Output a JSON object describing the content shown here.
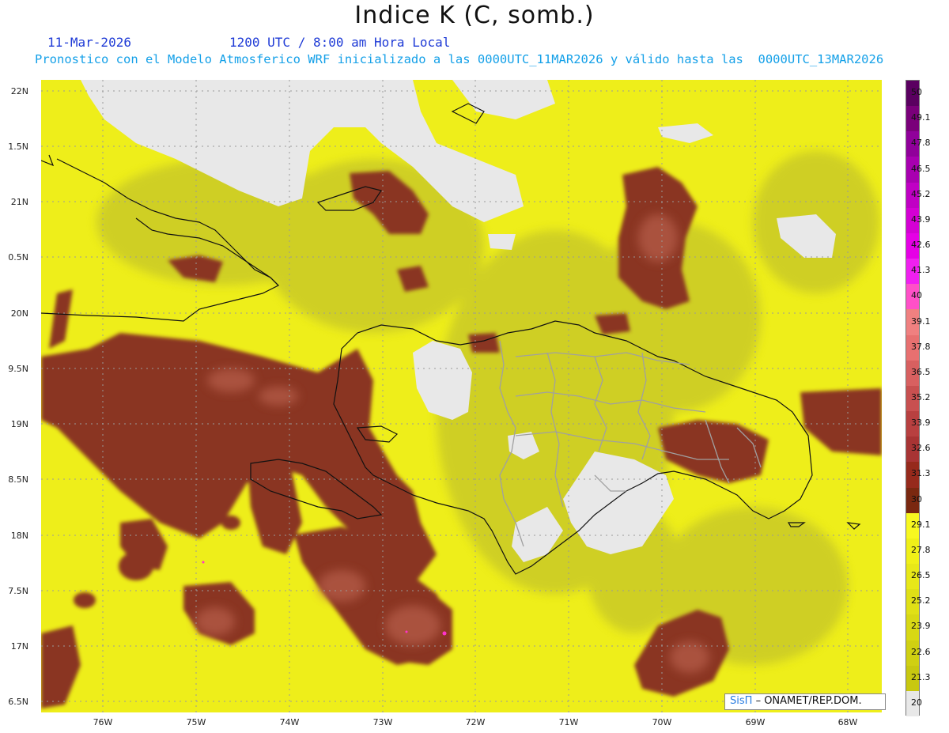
{
  "header": {
    "title": "Indice K (C, somb.)",
    "date": "11-Mar-2026",
    "time": "1200 UTC / 8:00 am Hora Local",
    "forecast_line": "Pronostico con el Modelo Atmosferico WRF inicializado a las 0000UTC_11MAR2026 y válido hasta las  0000UTC_13MAR2026"
  },
  "axes": {
    "lat_labels": [
      "22N",
      "1.5N",
      "21N",
      "0.5N",
      "20N",
      "9.5N",
      "19N",
      "8.5N",
      "18N",
      "7.5N",
      "17N",
      "6.5N"
    ],
    "lon_labels": [
      "76W",
      "75W",
      "74W",
      "73W",
      "72W",
      "71W",
      "70W",
      "69W",
      "68W"
    ]
  },
  "colorbar": {
    "labels": [
      "50",
      "49.1",
      "47.8",
      "46.5",
      "45.2",
      "43.9",
      "42.6",
      "41.3",
      "40",
      "39.1",
      "37.8",
      "36.5",
      "35.2",
      "33.9",
      "32.6",
      "31.3",
      "30",
      "29.1",
      "27.8",
      "26.5",
      "25.2",
      "23.9",
      "22.6",
      "21.3",
      "20"
    ],
    "colors": [
      "#5a0060",
      "#7a007a",
      "#90009a",
      "#a800b0",
      "#c000c4",
      "#d400d4",
      "#e600e6",
      "#f020f0",
      "#ff50c8",
      "#f08080",
      "#e87070",
      "#d86060",
      "#c85050",
      "#b84040",
      "#a83434",
      "#962a1c",
      "#7a2810",
      "#f8f820",
      "#f0f018",
      "#e8e818",
      "#e0e016",
      "#d8d814",
      "#d0d012",
      "#c8c810",
      "#e8e8e8"
    ]
  },
  "credit": {
    "logo": "SisΠ",
    "org": "– ONAMET/REP.DOM."
  },
  "palette": {
    "base": "#eeee1a",
    "low": "#cccc2a",
    "high": "#8a3522",
    "high_light": "#b55a48",
    "peak": "#ff33cc",
    "land_missing": "#e8e8e8"
  }
}
